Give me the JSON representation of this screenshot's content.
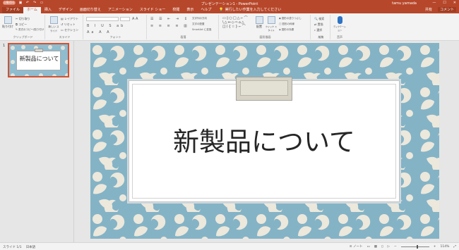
{
  "window": {
    "title": "プレゼンテーション1 - PowerPoint",
    "user": "tamu yamada",
    "autosave_label": "自動保存",
    "controls": {
      "minimize": "—",
      "maximize": "☐",
      "close": "✕"
    }
  },
  "qat": {
    "save_icon": "save-icon",
    "undo_icon": "undo-icon",
    "redo_icon": "redo-icon",
    "present_icon": "present-icon"
  },
  "tabs": [
    {
      "label": "ファイル",
      "active": false,
      "file": true
    },
    {
      "label": "ホーム",
      "active": true
    },
    {
      "label": "挿入"
    },
    {
      "label": "デザイン"
    },
    {
      "label": "画面切り替え"
    },
    {
      "label": "アニメーション"
    },
    {
      "label": "スライド ショー"
    },
    {
      "label": "校閲"
    },
    {
      "label": "表示"
    },
    {
      "label": "ヘルプ"
    }
  ],
  "tell_me": "実行したい作業を入力してください",
  "share_label": "共有",
  "comment_label": "コメント",
  "ribbon": {
    "clipboard": {
      "label": "クリップボード",
      "paste": "貼り付け",
      "cut": "切り取り",
      "copy": "コピー",
      "format_painter": "書式のコピー/貼り付け"
    },
    "slides": {
      "label": "スライド",
      "new_slide": "新しい スライド",
      "layout": "レイアウト",
      "reset": "リセット",
      "section": "セクション"
    },
    "font": {
      "label": "フォント"
    },
    "paragraph": {
      "label": "段落",
      "text_direction": "文字列の方向",
      "align_text": "文字の配置",
      "smartart": "SmartArt に変換"
    },
    "drawing": {
      "label": "図形描画",
      "arrange": "配置",
      "quick_styles": "クイック スタイル",
      "shape_fill": "図形の塗りつぶし",
      "shape_outline": "図形の枠線",
      "shape_effects": "図形の効果"
    },
    "editing": {
      "label": "編集",
      "find": "検索",
      "replace": "置換",
      "select": "選択"
    },
    "voice": {
      "label": "音声",
      "dictate": "ディクテーション"
    }
  },
  "thumbnail": {
    "number": "1",
    "title": "新製品について"
  },
  "slide": {
    "title": "新製品について"
  },
  "status": {
    "slide_of": "スライド 1/1",
    "language": "日本語",
    "notes": "ノート",
    "zoom": "114%"
  },
  "colors": {
    "accent": "#b7472a",
    "slide_bg": "#84b3c6",
    "pattern": "#ece8dc"
  }
}
